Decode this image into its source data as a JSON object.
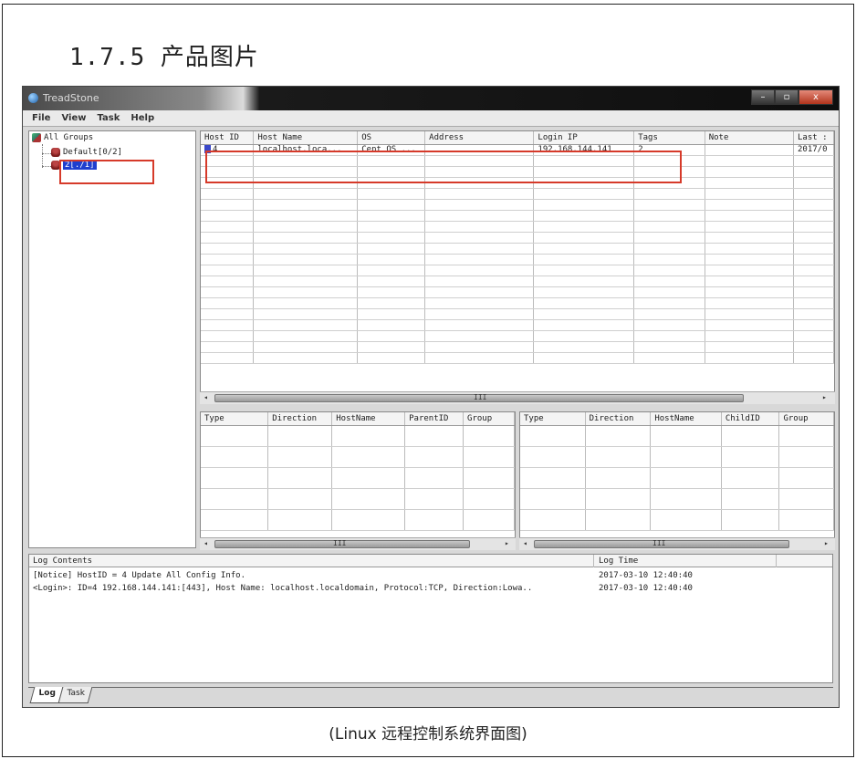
{
  "document": {
    "heading": "1.7.5  产品图片",
    "caption": "(Linux 远程控制系统界面图)"
  },
  "app": {
    "title": "TreadStone",
    "window_buttons": [
      "–",
      "▫",
      "x"
    ],
    "menu": [
      "File",
      "View",
      "Task",
      "Help"
    ],
    "tree": {
      "root": "All Groups",
      "default_group": "Default[0/2]",
      "selected_group": "2[./1]"
    },
    "hosts_table": {
      "columns": [
        "Host ID",
        "Host Name",
        "OS",
        "Address",
        "Login IP",
        "Tags",
        "Note",
        "Last :"
      ],
      "rows": [
        [
          "4",
          "localhost.loca...",
          "Cent OS ...",
          "",
          "192.168.144.141",
          "2",
          "",
          "2017/0"
        ]
      ],
      "empty_rows": 19
    },
    "connections_left": {
      "columns": [
        "Type",
        "Direction",
        "HostName",
        "ParentID",
        "Group"
      ]
    },
    "connections_right": {
      "columns": [
        "Type",
        "Direction",
        "HostName",
        "ChildID",
        "Group"
      ]
    },
    "log": {
      "columns": [
        "Log Contents",
        "Log Time"
      ],
      "rows": [
        {
          "content": "[Notice] HostID = 4 Update All Config Info.",
          "time": "2017-03-10 12:40:40"
        },
        {
          "content": "<Login>: ID=4 192.168.144.141:[443], Host Name: localhost.localdomain, Protocol:TCP, Direction:Lowa..",
          "time": "2017-03-10 12:40:40"
        }
      ]
    },
    "tabs": [
      "Log",
      "Task"
    ],
    "scroll_grip": "III"
  },
  "colors": {
    "highlight": "#d63a2a",
    "selection": "#1f3fd0"
  }
}
